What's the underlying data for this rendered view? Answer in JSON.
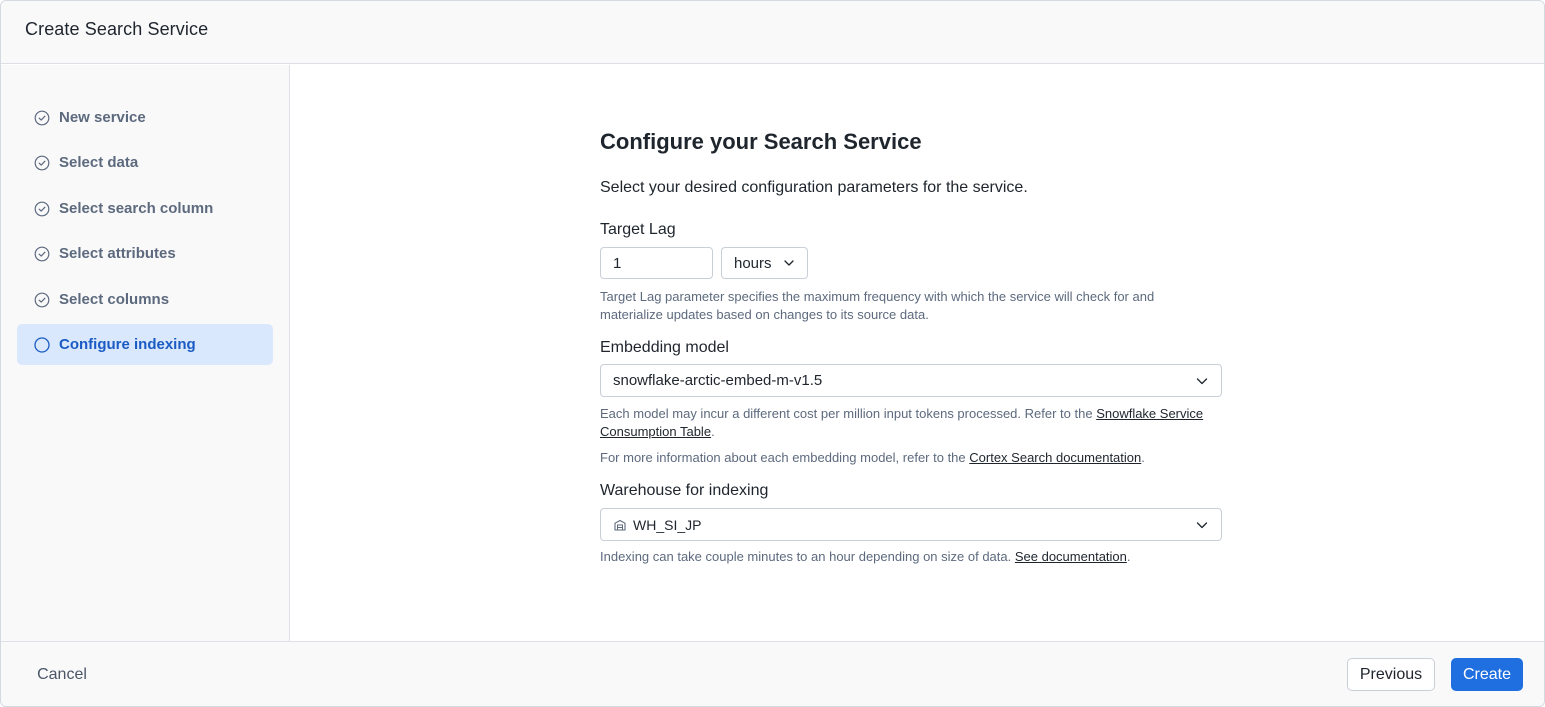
{
  "header": {
    "title": "Create Search Service"
  },
  "steps": [
    {
      "label": "New service",
      "status": "completed",
      "icon": "check-circle-icon"
    },
    {
      "label": "Select data",
      "status": "completed",
      "icon": "check-circle-icon"
    },
    {
      "label": "Select search column",
      "status": "completed",
      "icon": "check-circle-icon"
    },
    {
      "label": "Select attributes",
      "status": "completed",
      "icon": "check-circle-icon"
    },
    {
      "label": "Select columns",
      "status": "completed",
      "icon": "check-circle-icon"
    },
    {
      "label": "Configure indexing",
      "status": "active",
      "icon": "circle-icon"
    }
  ],
  "main": {
    "title": "Configure your Search Service",
    "subtitle": "Select your desired configuration parameters for the service.",
    "target_lag": {
      "label": "Target Lag",
      "value": "1",
      "unit": "hours",
      "help": "Target Lag parameter specifies the maximum frequency with which the service will check for and materialize updates based on changes to its source data."
    },
    "embedding": {
      "label": "Embedding model",
      "value": "snowflake-arctic-embed-m-v1.5",
      "help_prefix": "Each model may incur a different cost per million input tokens processed. Refer to the ",
      "help_link": "Snowflake Service Consumption Table",
      "help_suffix": ".",
      "help2_prefix": "For more information about each embedding model, refer to the ",
      "help2_link": "Cortex Search documentation",
      "help2_suffix": "."
    },
    "warehouse": {
      "label": "Warehouse for indexing",
      "value": "WH_SI_JP",
      "icon": "warehouse-icon",
      "help_prefix": "Indexing can take couple minutes to an hour depending on size of data. ",
      "help_link": "See documentation",
      "help_suffix": "."
    }
  },
  "footer": {
    "cancel": "Cancel",
    "previous": "Previous",
    "create": "Create"
  },
  "colors": {
    "accent": "#1f6fe0",
    "active_step_bg": "#d9e8fc",
    "active_step_text": "#1a5bc4"
  }
}
